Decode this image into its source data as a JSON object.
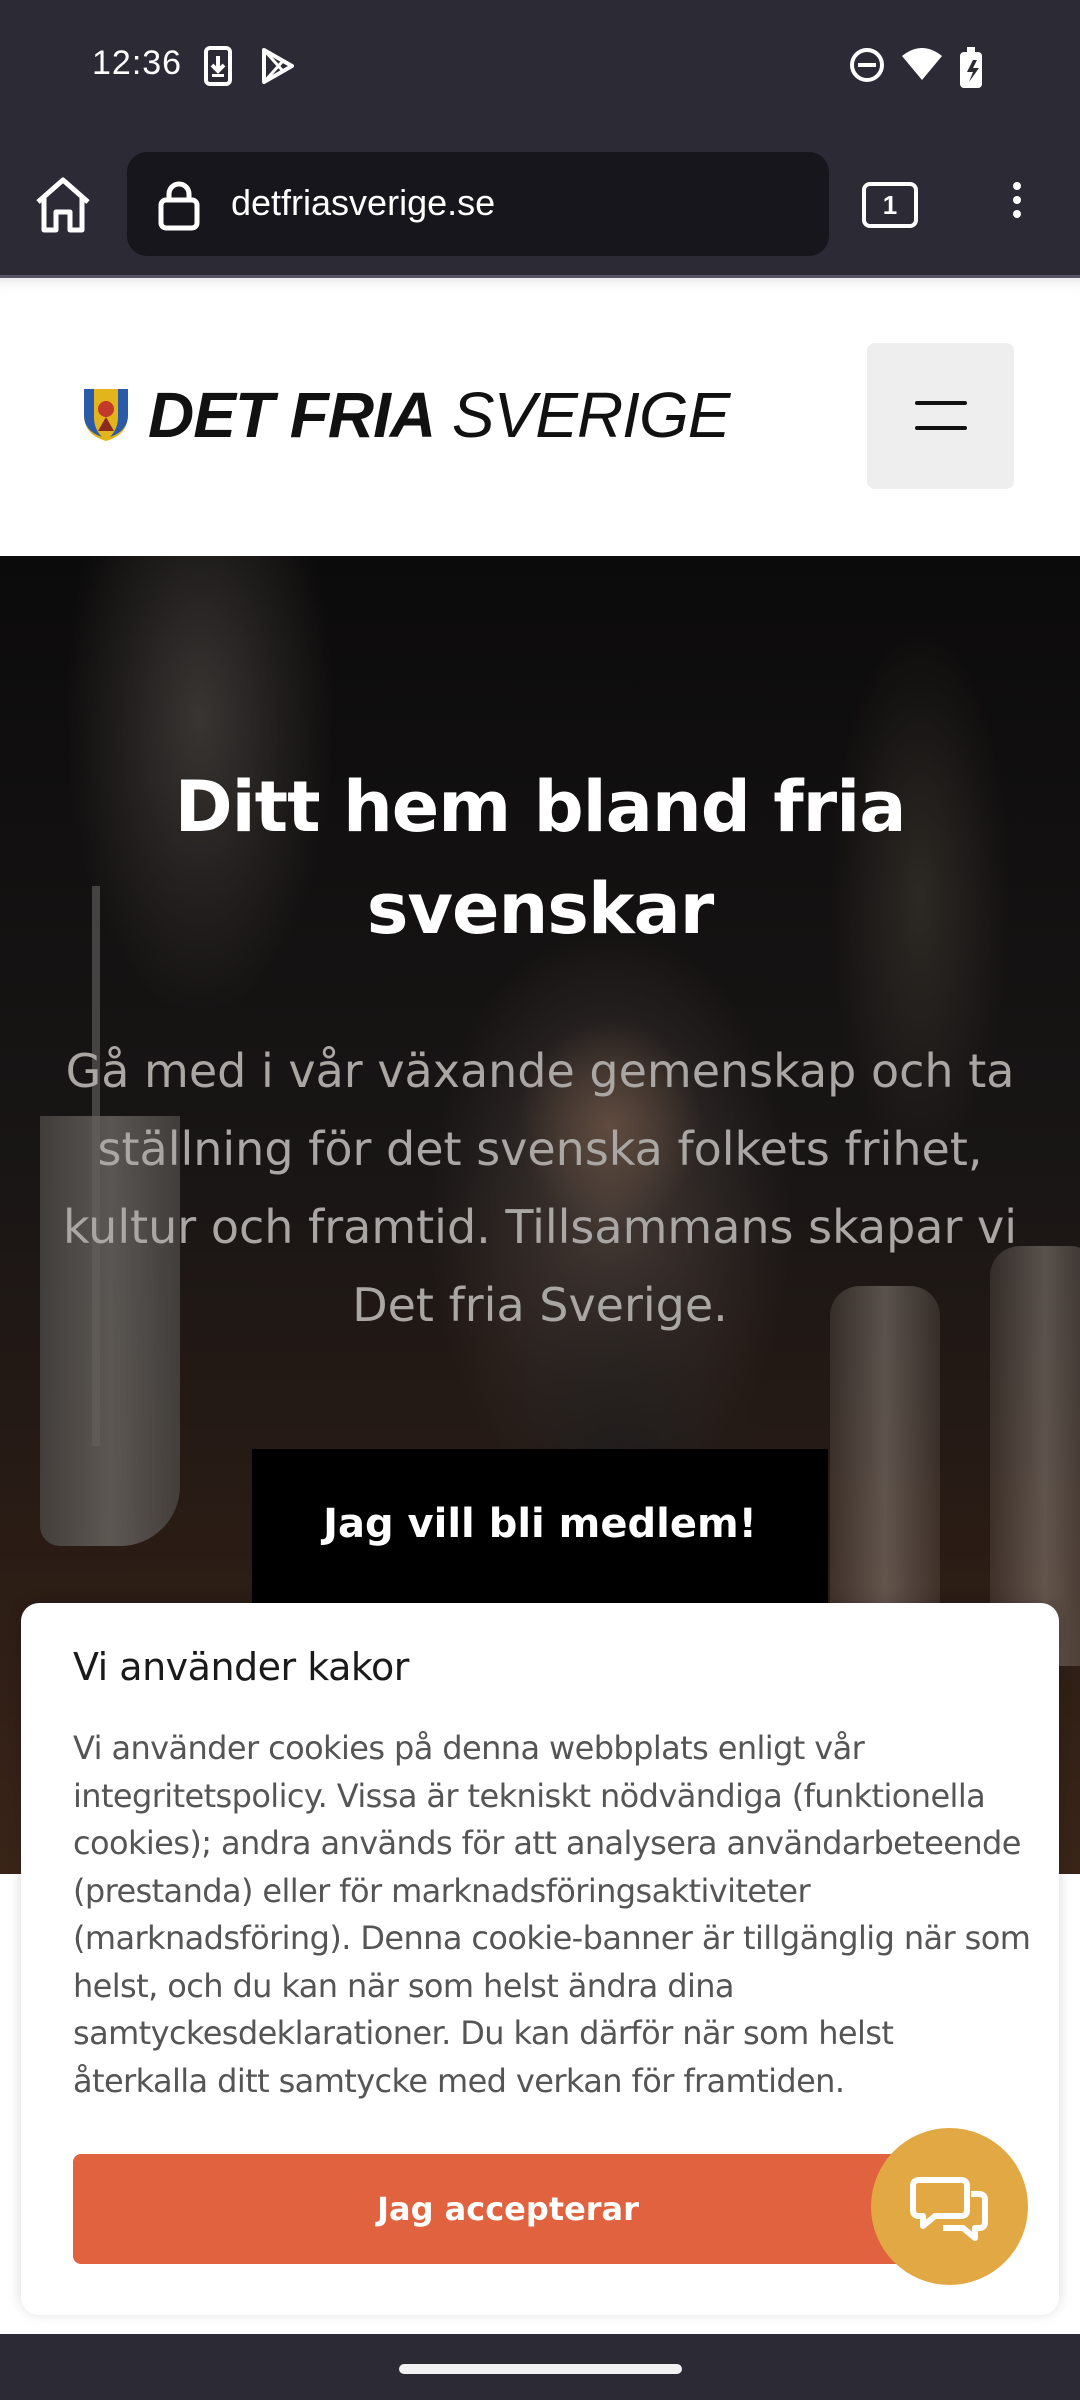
{
  "status_bar": {
    "time": "12:36",
    "left_icons": [
      "download-notification-icon",
      "play-store-icon"
    ],
    "right_icons": [
      "do-not-disturb-icon",
      "wifi-icon",
      "battery-icon"
    ]
  },
  "browser": {
    "url": "detfriasverige.se",
    "tab_count": "1",
    "icons": [
      "home-icon",
      "lock-icon",
      "more-vert-icon"
    ]
  },
  "site": {
    "logo_bold": "DET FRIA",
    "logo_light": "SVERIGE",
    "menu_icon": "hamburger-icon"
  },
  "hero": {
    "title": "Ditt hem bland fria svenskar",
    "subtitle": "Gå med i vår växande gemenskap och ta ställning för det svenska folkets frihet,  kultur och framtid. Tillsammans skapar vi Det fria Sverige.",
    "cta_label": "Jag vill bli medlem!"
  },
  "cookie_banner": {
    "title": "Vi använder kakor",
    "body": "Vi använder cookies på denna webbplats enligt vår integritetspolicy. Vissa är tekniskt nödvändiga (funktionella cookies); andra används för att analysera användarbeteende (prestanda) eller för marknadsföringsaktiviteter (marknadsföring). Denna cookie-banner är tillgänglig när som helst, och du kan när som helst ändra dina samtyckesdeklarationer. Du kan därför när som helst återkalla ditt samtycke med verkan för framtiden.",
    "accept_label": "Jag accepterar"
  },
  "chat": {
    "icon": "chat-bubbles-icon"
  },
  "colors": {
    "system_bar": "#2b2a35",
    "accept_button": "#e0623f",
    "chat_button": "#e2a843"
  }
}
